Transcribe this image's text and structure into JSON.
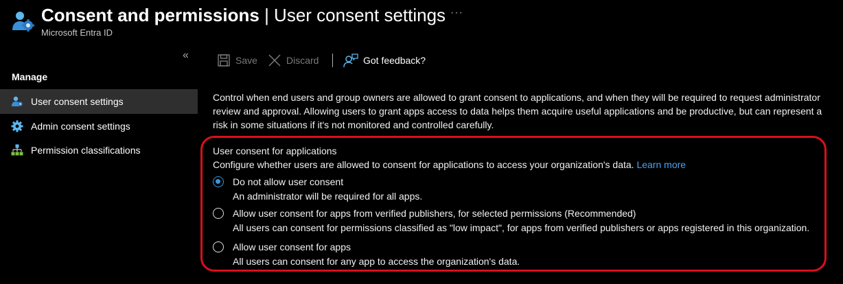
{
  "header": {
    "title_bold": "Consent and permissions",
    "title_separator": " | ",
    "title_light": "User consent settings",
    "subtitle": "Microsoft Entra ID",
    "more_label": "···",
    "icon": "users-gear-icon"
  },
  "sidebar": {
    "collapse_label": "«",
    "section_label": "Manage",
    "items": [
      {
        "label": "User consent settings",
        "icon": "user-gear-icon",
        "active": true
      },
      {
        "label": "Admin consent settings",
        "icon": "gear-icon",
        "active": false
      },
      {
        "label": "Permission classifications",
        "icon": "hierarchy-icon",
        "active": false
      }
    ]
  },
  "toolbar": {
    "save_label": "Save",
    "discard_label": "Discard",
    "feedback_label": "Got feedback?"
  },
  "main": {
    "description": "Control when end users and group owners are allowed to grant consent to applications, and when they will be required to request administrator review and approval. Allowing users to grant apps access to data helps them acquire useful applications and be productive, but can represent a risk in some situations if it's not monitored and controlled carefully.",
    "section_title": "User consent for applications",
    "section_desc": "Configure whether users are allowed to consent for applications to access your organization's data.",
    "learn_more": "Learn more",
    "options": [
      {
        "label": "Do not allow user consent",
        "desc": "An administrator will be required for all apps.",
        "selected": true
      },
      {
        "label": "Allow user consent for apps from verified publishers, for selected permissions (Recommended)",
        "desc": "All users can consent for permissions classified as \"low impact\", for apps from verified publishers or apps registered in this organization.",
        "selected": false
      },
      {
        "label": "Allow user consent for apps",
        "desc": "All users can consent for any app to access the organization's data.",
        "selected": false
      }
    ]
  },
  "colors": {
    "accent": "#3a96dd",
    "link": "#4aa3f0",
    "highlight_border": "#d8101c",
    "background": "#000000",
    "active_nav": "#2f2f2f"
  }
}
